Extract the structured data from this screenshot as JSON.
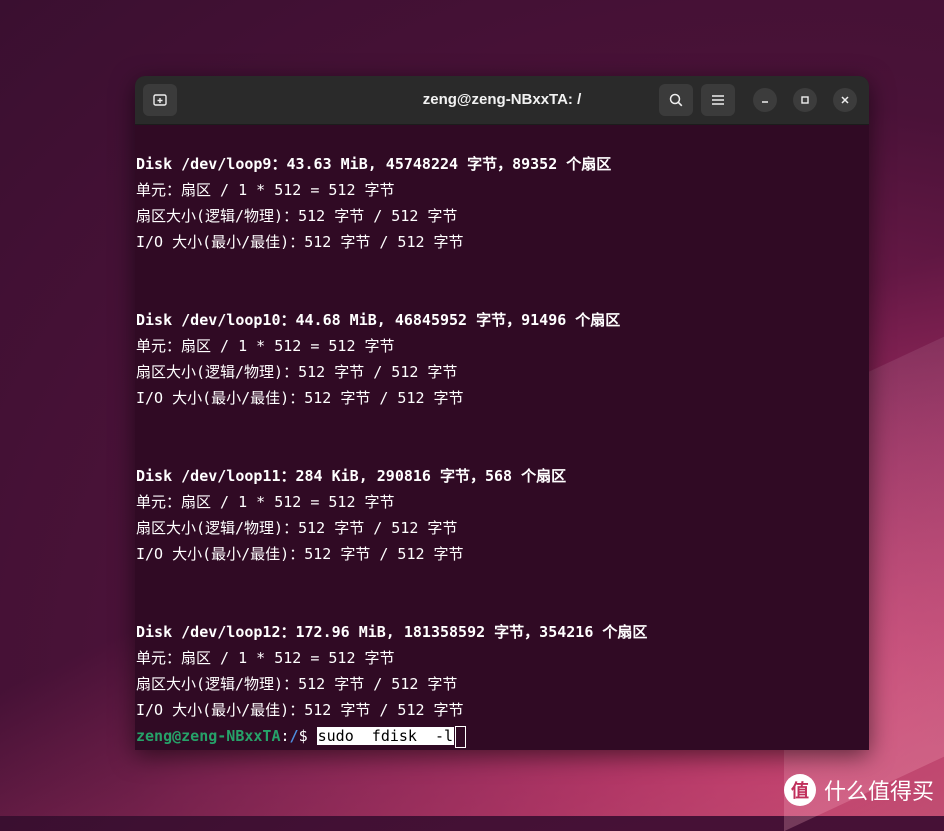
{
  "window": {
    "title": "zeng@zeng-NBxxTA: /"
  },
  "icons": {
    "new_tab": "new-tab-icon",
    "search": "search-icon",
    "menu": "hamburger-menu-icon",
    "minimize": "minimize-icon",
    "maximize": "maximize-icon",
    "close": "close-icon"
  },
  "terminal": {
    "lines": [
      {
        "text": "",
        "bold": false
      },
      {
        "text": "Disk /dev/loop9：43.63 MiB, 45748224 字节，89352 个扇区",
        "bold": true
      },
      {
        "text": "单元：扇区 / 1 * 512 = 512 字节",
        "bold": false
      },
      {
        "text": "扇区大小(逻辑/物理)：512 字节 / 512 字节",
        "bold": false
      },
      {
        "text": "I/O 大小(最小/最佳)：512 字节 / 512 字节",
        "bold": false
      },
      {
        "text": "",
        "bold": false
      },
      {
        "text": "",
        "bold": false
      },
      {
        "text": "Disk /dev/loop10：44.68 MiB, 46845952 字节，91496 个扇区",
        "bold": true
      },
      {
        "text": "单元：扇区 / 1 * 512 = 512 字节",
        "bold": false
      },
      {
        "text": "扇区大小(逻辑/物理)：512 字节 / 512 字节",
        "bold": false
      },
      {
        "text": "I/O 大小(最小/最佳)：512 字节 / 512 字节",
        "bold": false
      },
      {
        "text": "",
        "bold": false
      },
      {
        "text": "",
        "bold": false
      },
      {
        "text": "Disk /dev/loop11：284 KiB, 290816 字节，568 个扇区",
        "bold": true
      },
      {
        "text": "单元：扇区 / 1 * 512 = 512 字节",
        "bold": false
      },
      {
        "text": "扇区大小(逻辑/物理)：512 字节 / 512 字节",
        "bold": false
      },
      {
        "text": "I/O 大小(最小/最佳)：512 字节 / 512 字节",
        "bold": false
      },
      {
        "text": "",
        "bold": false
      },
      {
        "text": "",
        "bold": false
      },
      {
        "text": "Disk /dev/loop12：172.96 MiB, 181358592 字节，354216 个扇区",
        "bold": true
      },
      {
        "text": "单元：扇区 / 1 * 512 = 512 字节",
        "bold": false
      },
      {
        "text": "扇区大小(逻辑/物理)：512 字节 / 512 字节",
        "bold": false
      },
      {
        "text": "I/O 大小(最小/最佳)：512 字节 / 512 字节",
        "bold": false
      }
    ],
    "prompt": {
      "user_host": "zeng@zeng-NBxxTA",
      "sep": ":",
      "path": "/",
      "symbol": "$ ",
      "command": "sudo  fdisk  -l"
    }
  },
  "watermark": {
    "icon_char": "值",
    "text": "什么值得买"
  }
}
